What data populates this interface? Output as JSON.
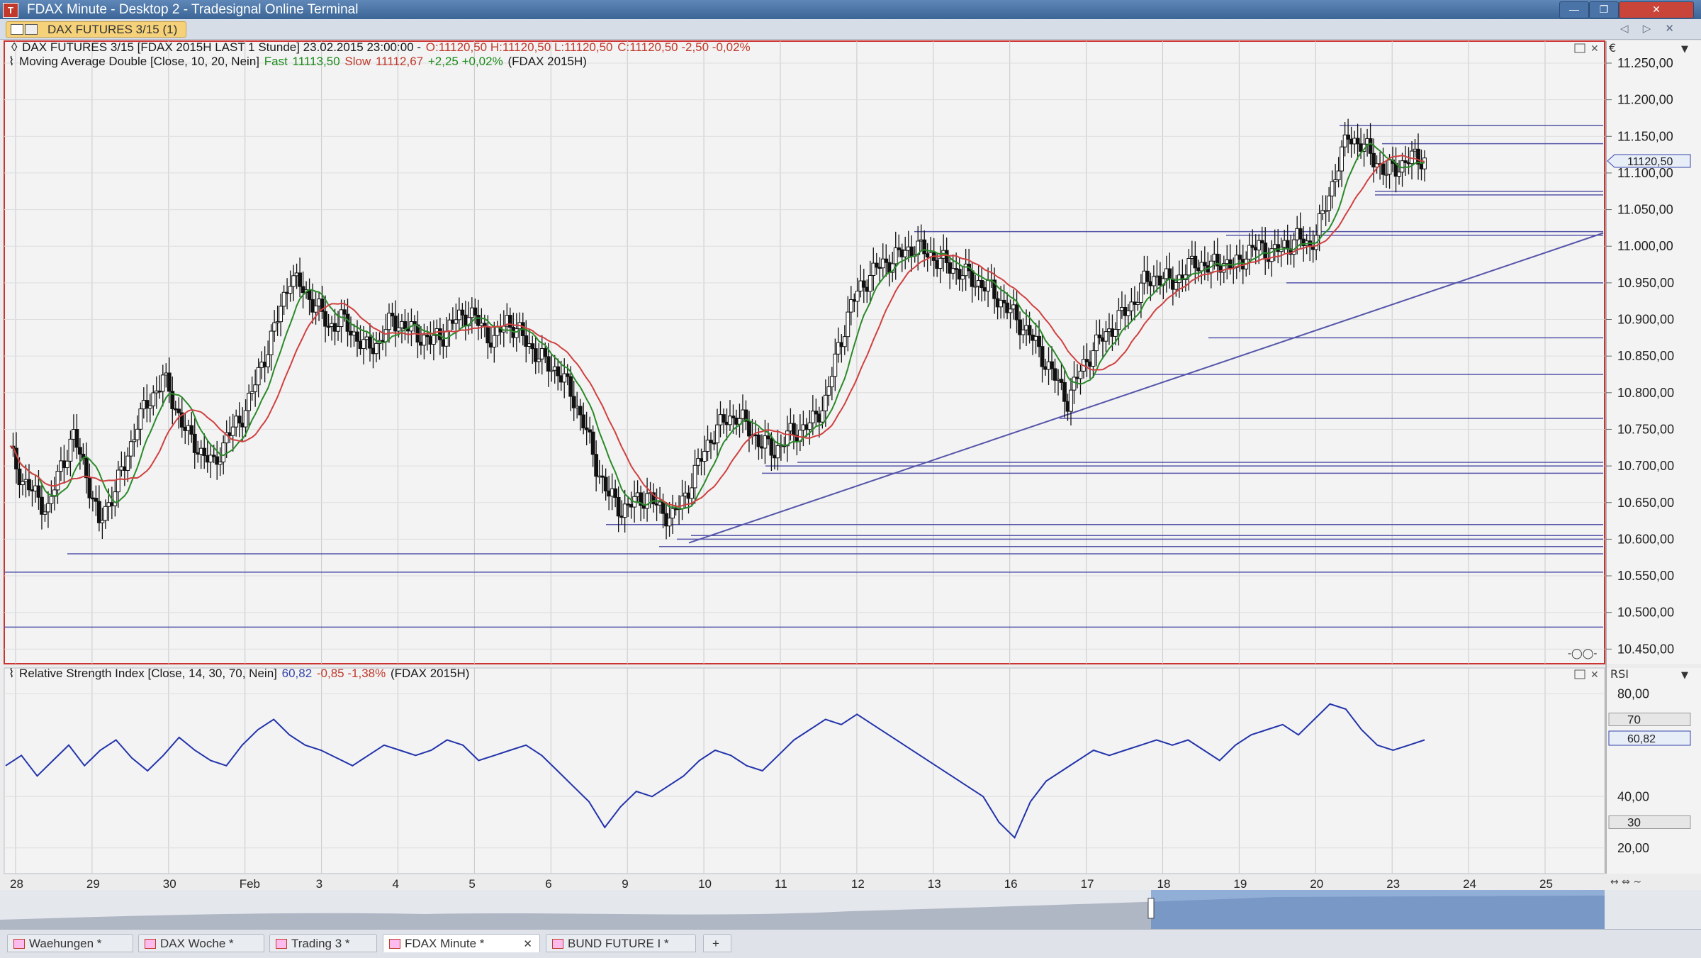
{
  "window": {
    "title": "FDAX Minute - Desktop 2 - Tradesignal Online Terminal",
    "app_icon": "tradesignal-logo-icon"
  },
  "toolbar": {
    "active_chart_tab": "DAX FUTURES 3/15 (1)"
  },
  "price_pane": {
    "legend_symbol": "DAX FUTURES 3/15 [FDAX 2015H LAST 1 Stunde] 23.02.2015 23:00:00 -",
    "legend_ohlc": "O:11120,50 H:11120,50 L:11120,50",
    "legend_close": "C:11120,50 -2,50 -0,02%",
    "ma_label": "Moving Average Double [Close, 10, 20, Nein]",
    "ma_fast_label": "Fast",
    "ma_fast_value": "11113,50",
    "ma_slow_label": "Slow",
    "ma_slow_value": "11112,67",
    "ma_change": "+2,25 +0,02%",
    "ma_symbol": "(FDAX 2015H)",
    "last_price_tag": "11120,50",
    "axis_currency": "€"
  },
  "rsi_pane": {
    "label": "Relative Strength Index [Close, 14, 30, 70, Nein]",
    "value": "60,82",
    "change": "-0,85 -1,38%",
    "symbol": "(FDAX 2015H)",
    "axis_title": "RSI",
    "tag_value": "60,82"
  },
  "chart_data": [
    {
      "type": "candlestick",
      "title": "DAX FUTURES 3/15 [FDAX 2015H LAST 1 Stunde]",
      "ylim": [
        10430,
        11280
      ],
      "y_ticks": [
        "10.450,00",
        "10.500,00",
        "10.550,00",
        "10.600,00",
        "10.650,00",
        "10.700,00",
        "10.750,00",
        "10.800,00",
        "10.850,00",
        "10.900,00",
        "10.950,00",
        "11.000,00",
        "11.050,00",
        "11.100,00",
        "11.150,00",
        "11.200,00",
        "11.250,00"
      ],
      "x_tick_labels": [
        "28",
        "29",
        "30",
        "Feb",
        "3",
        "4",
        "5",
        "6",
        "9",
        "10",
        "11",
        "12",
        "13",
        "16",
        "17",
        "18",
        "19",
        "20",
        "23",
        "24",
        "25"
      ],
      "close_series": [
        10720,
        10680,
        10660,
        10640,
        10700,
        10740,
        10690,
        10620,
        10660,
        10700,
        10760,
        10790,
        10820,
        10780,
        10740,
        10720,
        10700,
        10740,
        10760,
        10800,
        10850,
        10900,
        10960,
        10940,
        10920,
        10890,
        10900,
        10880,
        10860,
        10870,
        10900,
        10890,
        10880,
        10870,
        10880,
        10900,
        10910,
        10890,
        10870,
        10900,
        10880,
        10860,
        10840,
        10830,
        10800,
        10760,
        10700,
        10660,
        10640,
        10650,
        10660,
        10640,
        10630,
        10660,
        10700,
        10740,
        10760,
        10770,
        10750,
        10730,
        10720,
        10740,
        10750,
        10760,
        10790,
        10860,
        10920,
        10950,
        10970,
        10980,
        10990,
        11000,
        10990,
        10980,
        10970,
        10960,
        10950,
        10940,
        10920,
        10900,
        10880,
        10850,
        10820,
        10790,
        10830,
        10860,
        10880,
        10900,
        10920,
        10950,
        10960,
        10950,
        10960,
        10980,
        10970,
        10980,
        10970,
        10990,
        11000,
        10990,
        11000,
        11010,
        11000,
        11040,
        11100,
        11150,
        11140,
        11120,
        11100,
        11110,
        11120,
        11120
      ],
      "ma_fast_name": "Fast",
      "ma_slow_name": "Slow",
      "horizontal_lines": [
        11165,
        11140,
        11075,
        11070,
        11020,
        11015,
        10950,
        10875,
        10825,
        10765,
        10705,
        10700,
        10690,
        10620,
        10605,
        10600,
        10590,
        10580,
        10555,
        10480
      ],
      "trendline": {
        "from": [
          10595,
          0.4
        ],
        "to": [
          11018,
          0.998
        ]
      },
      "last_value": 11120.5
    },
    {
      "type": "line",
      "title": "Relative Strength Index [Close, 14, 30, 70, Nein]",
      "ylim": [
        10,
        90
      ],
      "y_ticks": [
        "20,00",
        "40,00",
        "80,00"
      ],
      "level_tags": [
        "70",
        "30"
      ],
      "values": [
        52,
        56,
        48,
        54,
        60,
        52,
        58,
        62,
        55,
        50,
        56,
        63,
        58,
        54,
        52,
        60,
        66,
        70,
        64,
        60,
        58,
        55,
        52,
        56,
        60,
        58,
        56,
        58,
        62,
        60,
        54,
        56,
        58,
        60,
        56,
        50,
        44,
        38,
        28,
        36,
        42,
        40,
        44,
        48,
        54,
        58,
        56,
        52,
        50,
        56,
        62,
        66,
        70,
        68,
        72,
        68,
        64,
        60,
        56,
        52,
        48,
        44,
        40,
        30,
        24,
        38,
        46,
        50,
        54,
        58,
        56,
        58,
        60,
        62,
        60,
        62,
        58,
        54,
        60,
        64,
        66,
        68,
        64,
        70,
        76,
        74,
        66,
        60,
        58,
        60,
        62
      ],
      "last_value": 60.82
    }
  ]
}
